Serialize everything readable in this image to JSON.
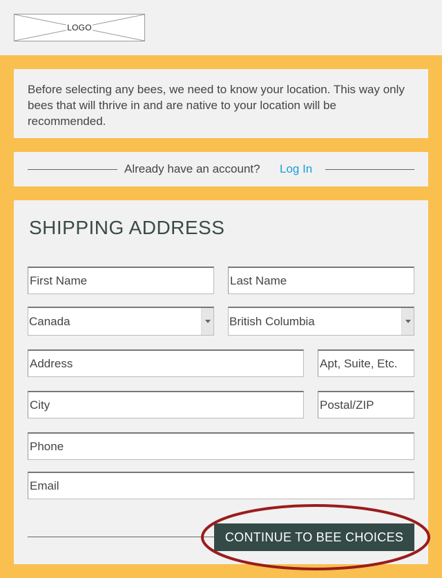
{
  "header": {
    "logo_text": "LOGO"
  },
  "notice": {
    "text": "Before selecting any bees, we need to know your location. This way only bees that will thrive in and are native to your location will be recommended."
  },
  "login": {
    "prompt": "Already have an account?",
    "link_label": "Log In"
  },
  "form": {
    "title": "SHIPPING ADDRESS",
    "first_name_placeholder": "First Name",
    "last_name_placeholder": "Last Name",
    "country_value": "Canada",
    "province_value": "British Columbia",
    "address_placeholder": "Address",
    "apt_placeholder": "Apt, Suite, Etc.",
    "city_placeholder": "City",
    "postal_placeholder": "Postal/ZIP",
    "phone_placeholder": "Phone",
    "email_placeholder": "Email",
    "continue_label": "CONTINUE TO BEE CHOICES"
  },
  "colors": {
    "accent_background": "#f9bf4f",
    "button": "#344a46",
    "link": "#1a9fd9",
    "highlight_ring": "#9b1c1c"
  }
}
